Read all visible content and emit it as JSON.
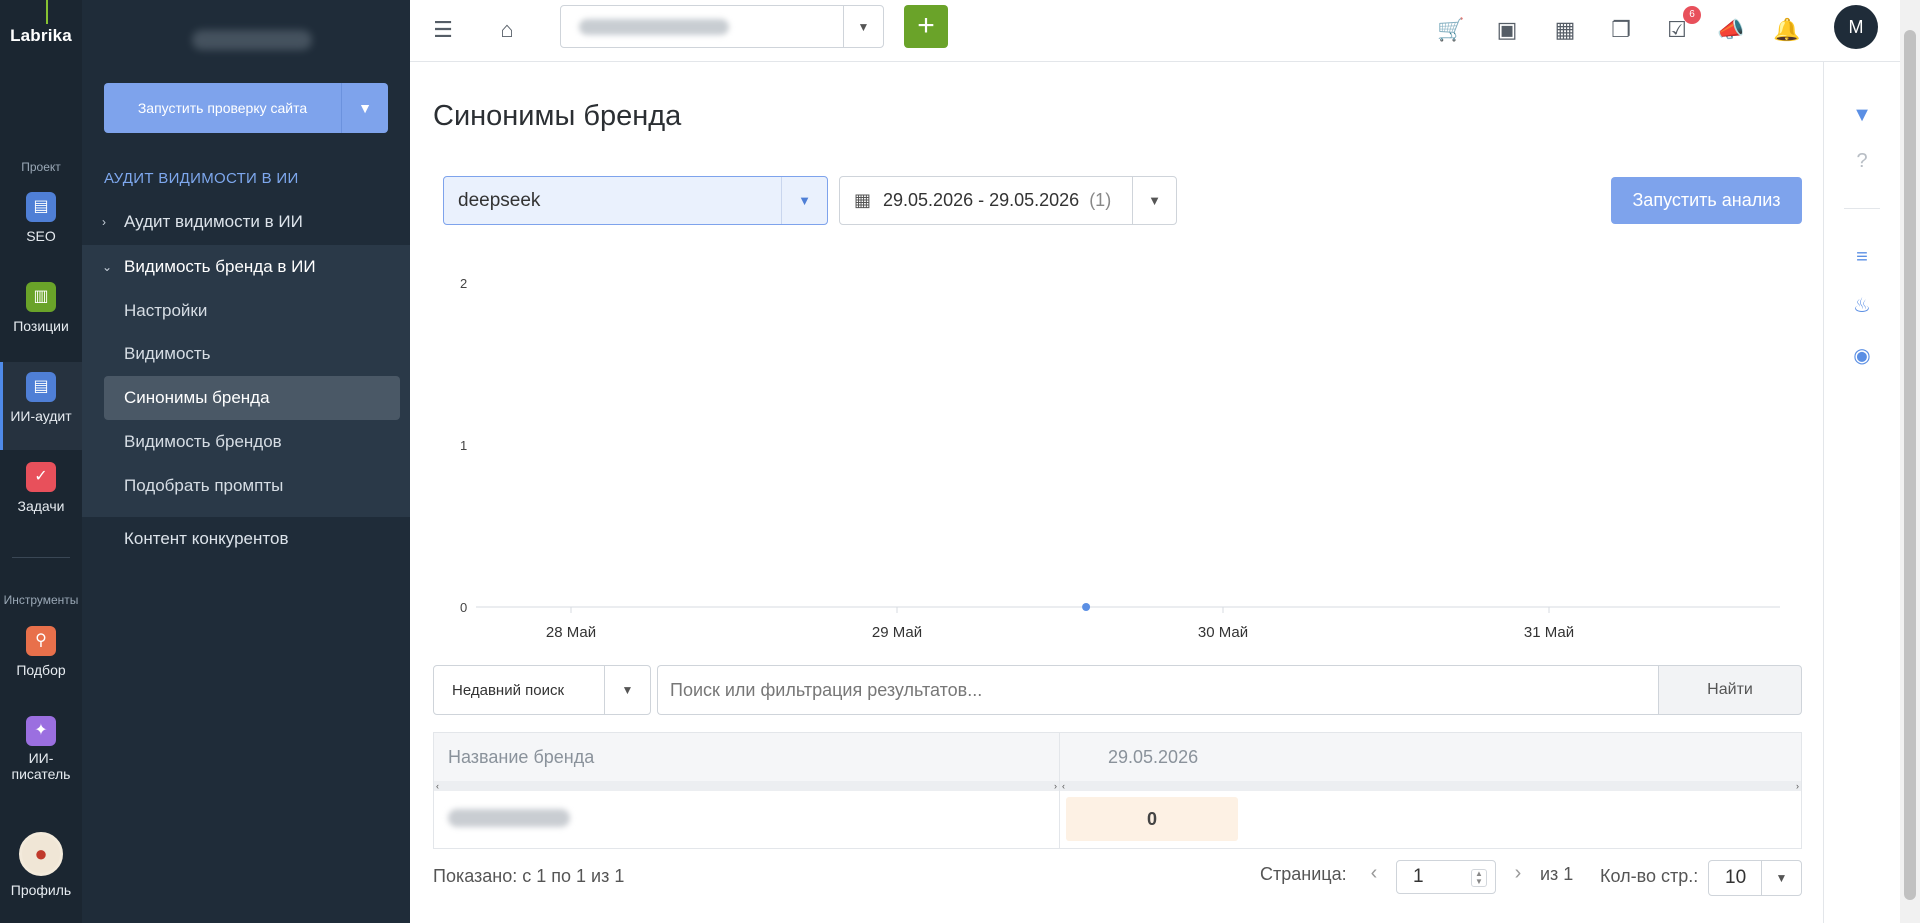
{
  "rail": {
    "logo": "Labrika",
    "section_project": "Проект",
    "section_tools": "Инструменты",
    "items": [
      {
        "label": "SEO",
        "icon": "clipboard-icon",
        "color": "#4f7fd6"
      },
      {
        "label": "Позиции",
        "icon": "chart-icon",
        "color": "#6aa329"
      },
      {
        "label": "ИИ-аудит",
        "icon": "clipboard-icon",
        "color": "#4f7fd6"
      },
      {
        "label": "Задачи",
        "icon": "check-icon",
        "color": "#e8505b"
      },
      {
        "label": "Подбор",
        "icon": "magnifier-icon",
        "color": "#e8704b"
      },
      {
        "label": "ИИ-писатель",
        "icon": "magic-wand-icon",
        "color": "#9b6fe0"
      },
      {
        "label": "Профиль",
        "icon": "profile-avatar-icon",
        "color": "#c0392b"
      }
    ]
  },
  "sidebar": {
    "run_check_label": "Запустить проверку сайта",
    "group_title": "АУДИТ ВИДИМОСТИ В ИИ",
    "nav": [
      {
        "label": "Аудит видимости в ИИ",
        "chevron": "›"
      },
      {
        "label": "Видимость бренда в ИИ",
        "chevron": "⌄"
      }
    ],
    "subitems": [
      {
        "label": "Настройки"
      },
      {
        "label": "Видимость"
      },
      {
        "label": "Синонимы бренда"
      },
      {
        "label": "Видимость брендов"
      },
      {
        "label": "Подобрать промпты"
      }
    ],
    "bottom_item": "Контент конкурентов"
  },
  "topbar": {
    "add_label": "+",
    "notification_count": "6",
    "user_initial": "M"
  },
  "main": {
    "title": "Синонимы бренда",
    "model_value": "deepseek",
    "date_range": "29.05.2026 - 29.05.2026",
    "date_count": "(1)",
    "run_analysis_label": "Запустить анализ"
  },
  "chart_data": {
    "type": "line",
    "x_ticks": [
      "28 Май",
      "29 Май",
      "30 Май",
      "31 Май"
    ],
    "y_ticks": [
      0,
      1,
      2
    ],
    "ylim": [
      0,
      2
    ],
    "series": [
      {
        "values": [
          {
            "x": "29.05.2026",
            "y": 0
          }
        ],
        "color": "#5b8fe4"
      }
    ],
    "grid": false,
    "legend": "none"
  },
  "search": {
    "recent_label": "Недавний поиск",
    "placeholder": "Поиск или фильтрация результатов...",
    "find_label": "Найти"
  },
  "table": {
    "headers": [
      "Название бренда",
      "29.05.2026"
    ],
    "rows": [
      {
        "value": "0"
      }
    ]
  },
  "footer": {
    "shown": "Показано: с 1 по 1 из 1",
    "page_label": "Страница:",
    "page_value": "1",
    "of_label": "из 1",
    "per_page_label": "Кол-во стр.:",
    "per_page_value": "10"
  }
}
